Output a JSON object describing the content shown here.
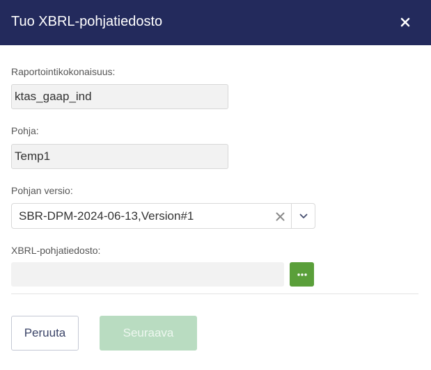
{
  "dialog": {
    "title": "Tuo XBRL-pohjatiedosto",
    "close_icon": "close-icon"
  },
  "fields": {
    "reporting_entity": {
      "label": "Raportointikokonaisuus:",
      "value": "ktas_gaap_ind"
    },
    "template": {
      "label": "Pohja:",
      "value": "Temp1"
    },
    "template_version": {
      "label": "Pohjan versio:",
      "value": "SBR-DPM-2024-06-13,Version#1",
      "clear_icon": "clear-icon",
      "toggle_icon": "chevron-down-icon"
    },
    "xbrl_file": {
      "label": "XBRL-pohjatiedosto:",
      "value": "",
      "browse_icon": "ellipsis-icon"
    }
  },
  "buttons": {
    "cancel": "Peruuta",
    "next": "Seuraava"
  },
  "colors": {
    "header_bg": "#232a5c",
    "browse_bg": "#5a9f3a",
    "next_disabled_bg": "#b9dcc1"
  }
}
